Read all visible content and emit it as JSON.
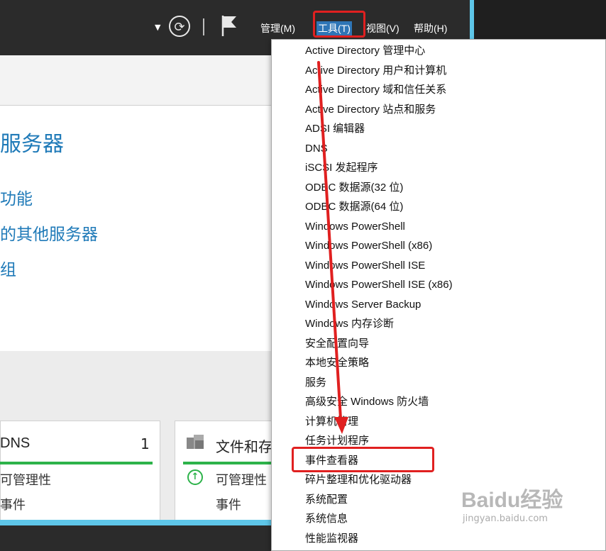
{
  "toolbar": {
    "dropdown_arrow": "▼",
    "menus": [
      {
        "label": "管理(M)"
      },
      {
        "label": "工具(T)"
      },
      {
        "label": "视图(V)"
      },
      {
        "label": "帮助(H)"
      }
    ]
  },
  "dashboard": {
    "title_fragment": "服务器",
    "links": [
      "功能",
      "的其他服务器",
      "组"
    ],
    "tiles": [
      {
        "title": "DNS",
        "count": "1",
        "status": "可管理性",
        "events": "事件"
      },
      {
        "title": "文件和存",
        "status": "可管理性",
        "events": "事件"
      }
    ]
  },
  "tools_menu": {
    "items": [
      "Active Directory 管理中心",
      "Active Directory 用户和计算机",
      "Active Directory 域和信任关系",
      "Active Directory 站点和服务",
      "ADSI 编辑器",
      "DNS",
      "iSCSI 发起程序",
      "ODBC 数据源(32 位)",
      "ODBC 数据源(64 位)",
      "Windows PowerShell",
      "Windows PowerShell (x86)",
      "Windows PowerShell ISE",
      "Windows PowerShell ISE (x86)",
      "Windows Server Backup",
      "Windows 内存诊断",
      "安全配置向导",
      "本地安全策略",
      "服务",
      "高级安全 Windows 防火墙",
      "计算机管理",
      "任务计划程序",
      "事件查看器",
      "碎片整理和优化驱动器",
      "系统配置",
      "系统信息",
      "性能监视器"
    ]
  },
  "watermark": {
    "brand": "Baidu",
    "brand_cn": "经验",
    "url": "jingyan.baidu.com"
  },
  "colors": {
    "accent": "#2e75b6",
    "link": "#1f7ab8",
    "annotation": "#e02020",
    "ok": "#2db34a"
  }
}
